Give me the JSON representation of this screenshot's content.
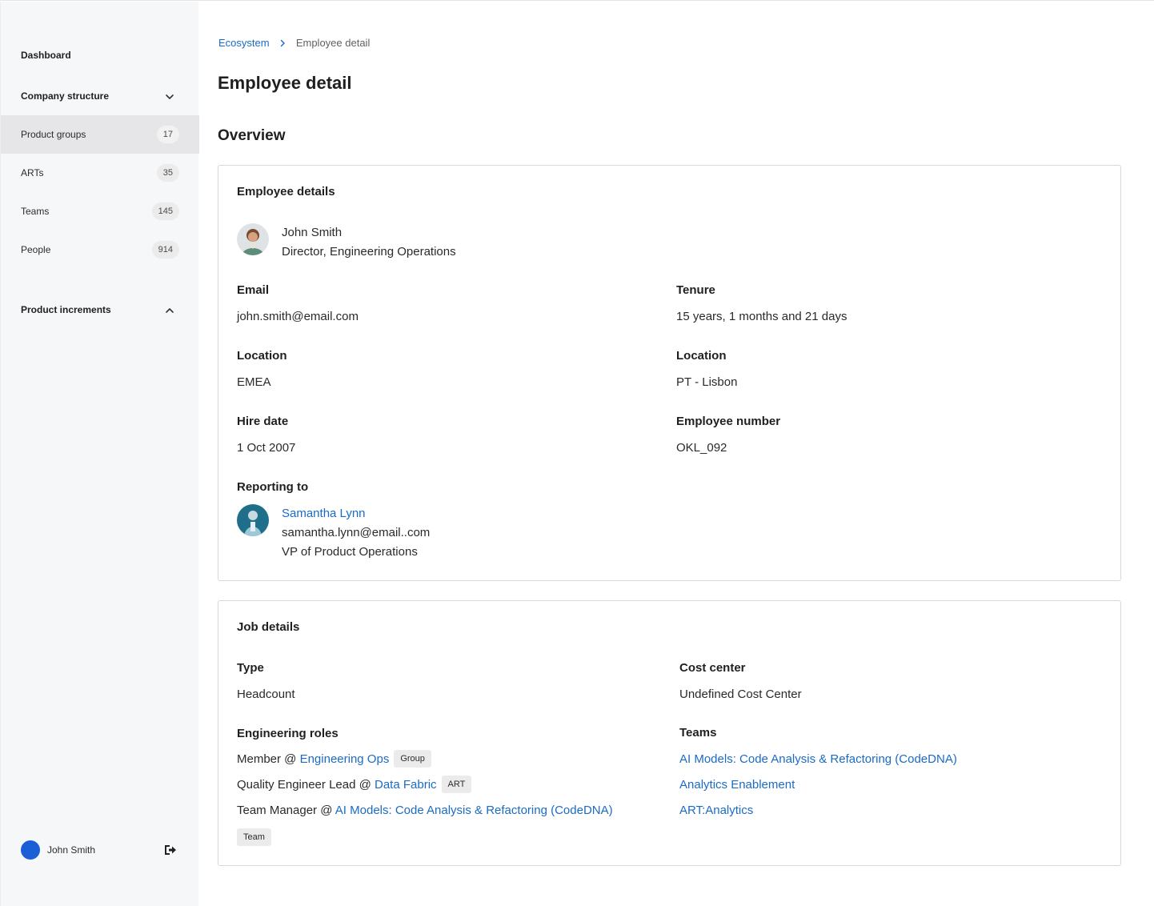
{
  "sidebar": {
    "dashboard": "Dashboard",
    "company_structure": "Company structure",
    "items": [
      {
        "label": "Product groups",
        "count": "17"
      },
      {
        "label": "ARTs",
        "count": "35"
      },
      {
        "label": "Teams",
        "count": "145"
      },
      {
        "label": "People",
        "count": "914"
      }
    ],
    "product_increments": "Product increments",
    "user_name": "John Smith",
    "active_item": "Product groups"
  },
  "breadcrumb": {
    "parent": "Ecosystem",
    "current": "Employee detail"
  },
  "page_title": "Employee detail",
  "section_title": "Overview",
  "employee_card": {
    "title": "Employee details",
    "name": "John Smith",
    "job_title": "Director, Engineering Operations",
    "email_label": "Email",
    "email_value": "john.smith@email.com",
    "tenure_label": "Tenure",
    "tenure_value": "15 years, 1 months and 21 days",
    "region_label": "Location",
    "region_value": "EMEA",
    "city_label": "Location",
    "city_value": "PT - Lisbon",
    "hire_label": "Hire date",
    "hire_value": "1 Oct 2007",
    "empno_label": "Employee number",
    "empno_value": "OKL_092",
    "reporting_label": "Reporting to",
    "manager_name": "Samantha Lynn",
    "manager_email": "samantha.lynn@email..com",
    "manager_title": "VP of Product Operations"
  },
  "job_card": {
    "title": "Job details",
    "type_label": "Type",
    "type_value": "Headcount",
    "cost_label": "Cost center",
    "cost_value": "Undefined Cost Center",
    "roles_label": "Engineering roles",
    "roles": [
      {
        "prefix": "Member @ ",
        "link": "Engineering Ops",
        "tag": "Group"
      },
      {
        "prefix": "Quality Engineer Lead @ ",
        "link": "Data Fabric",
        "tag": "ART"
      },
      {
        "prefix": "Team Manager @ ",
        "link": "AI Models: Code Analysis & Refactoring (CodeDNA)",
        "tag": "Team"
      }
    ],
    "teams_label": "Teams",
    "teams": [
      "AI Models: Code Analysis & Refactoring (CodeDNA)",
      "Analytics Enablement",
      "ART:Analytics"
    ]
  },
  "colors": {
    "link": "#1a6bc5",
    "user_avatar": "#1a5fd6",
    "sidebar_bg": "#f6f7f9",
    "active_item_bg": "#e6e6e8"
  },
  "icons": [
    "chevron-down-icon",
    "chevron-up-icon",
    "chevron-right-icon",
    "logout-icon"
  ]
}
